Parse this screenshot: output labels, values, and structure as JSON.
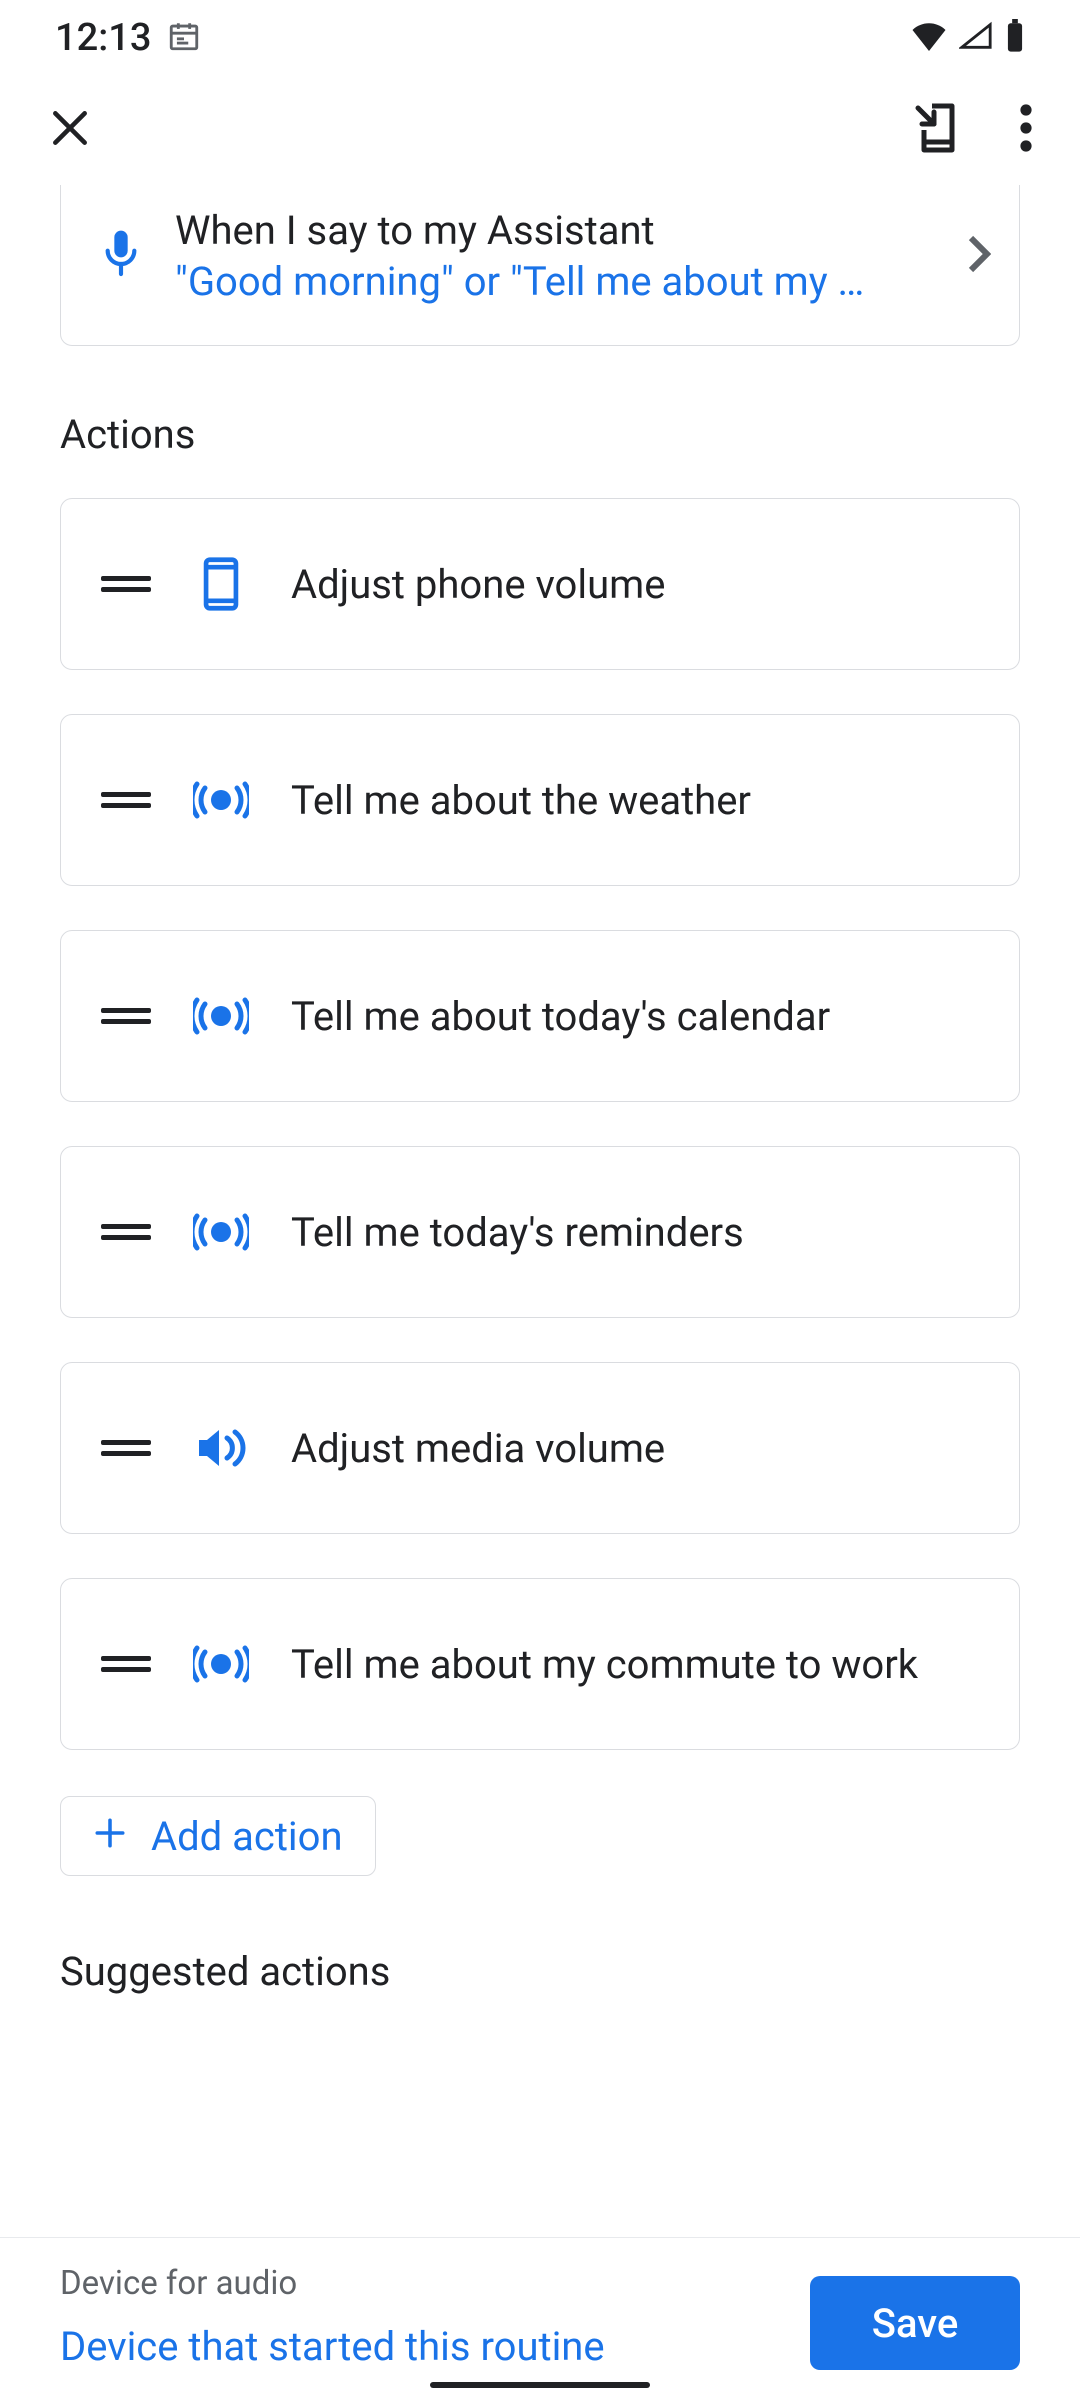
{
  "status": {
    "time": "12:13"
  },
  "trigger": {
    "title": "When I say to my Assistant",
    "phrase": "\"Good morning\" or \"Tell me about my …"
  },
  "sections": {
    "actions_header": "Actions",
    "suggested_header": "Suggested actions"
  },
  "actions": [
    {
      "label": "Adjust phone volume",
      "icon": "phone"
    },
    {
      "label": "Tell me about the weather",
      "icon": "assistant"
    },
    {
      "label": "Tell me about today's calendar",
      "icon": "assistant"
    },
    {
      "label": "Tell me today's reminders",
      "icon": "assistant"
    },
    {
      "label": "Adjust media volume",
      "icon": "media"
    },
    {
      "label": "Tell me about my commute to work",
      "icon": "assistant"
    }
  ],
  "add_action_label": "Add action",
  "footer": {
    "device_label": "Device for audio",
    "device_value": "Device that started this routine",
    "save_label": "Save"
  },
  "colors": {
    "accent": "#1a73e8"
  }
}
